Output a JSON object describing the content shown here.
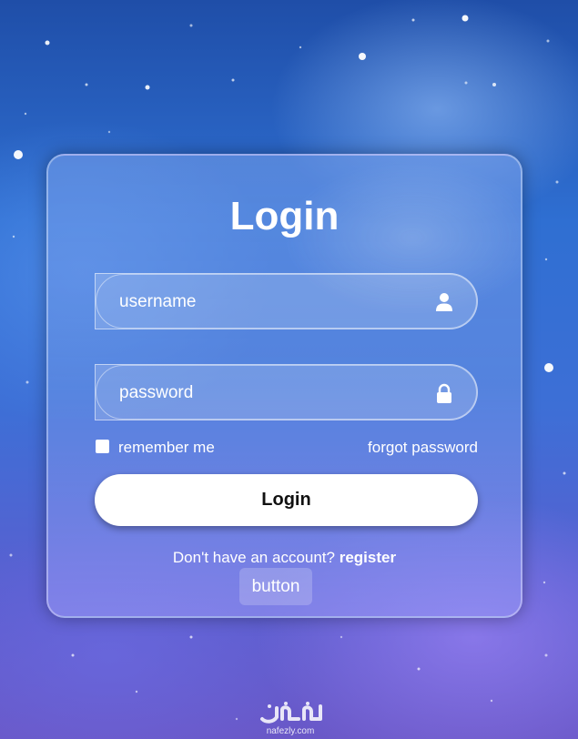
{
  "form": {
    "title": "Login",
    "username_placeholder": "username",
    "password_placeholder": "password",
    "remember_label": "remember me",
    "remember_checked": false,
    "forgot_label": "forgot password",
    "login_label": "Login",
    "register_prompt": "Don't have an account?",
    "register_label": "register",
    "extra_button_label": "button"
  },
  "icons": {
    "username": "user-icon",
    "password": "lock-icon"
  },
  "watermark": {
    "script": "نفذلي",
    "text": "nafezly.com"
  },
  "colors": {
    "background_top": "#1f4ea8",
    "background_bottom": "#6a58c8",
    "text": "#ffffff",
    "button_bg": "#ffffff",
    "button_text": "#111111"
  }
}
